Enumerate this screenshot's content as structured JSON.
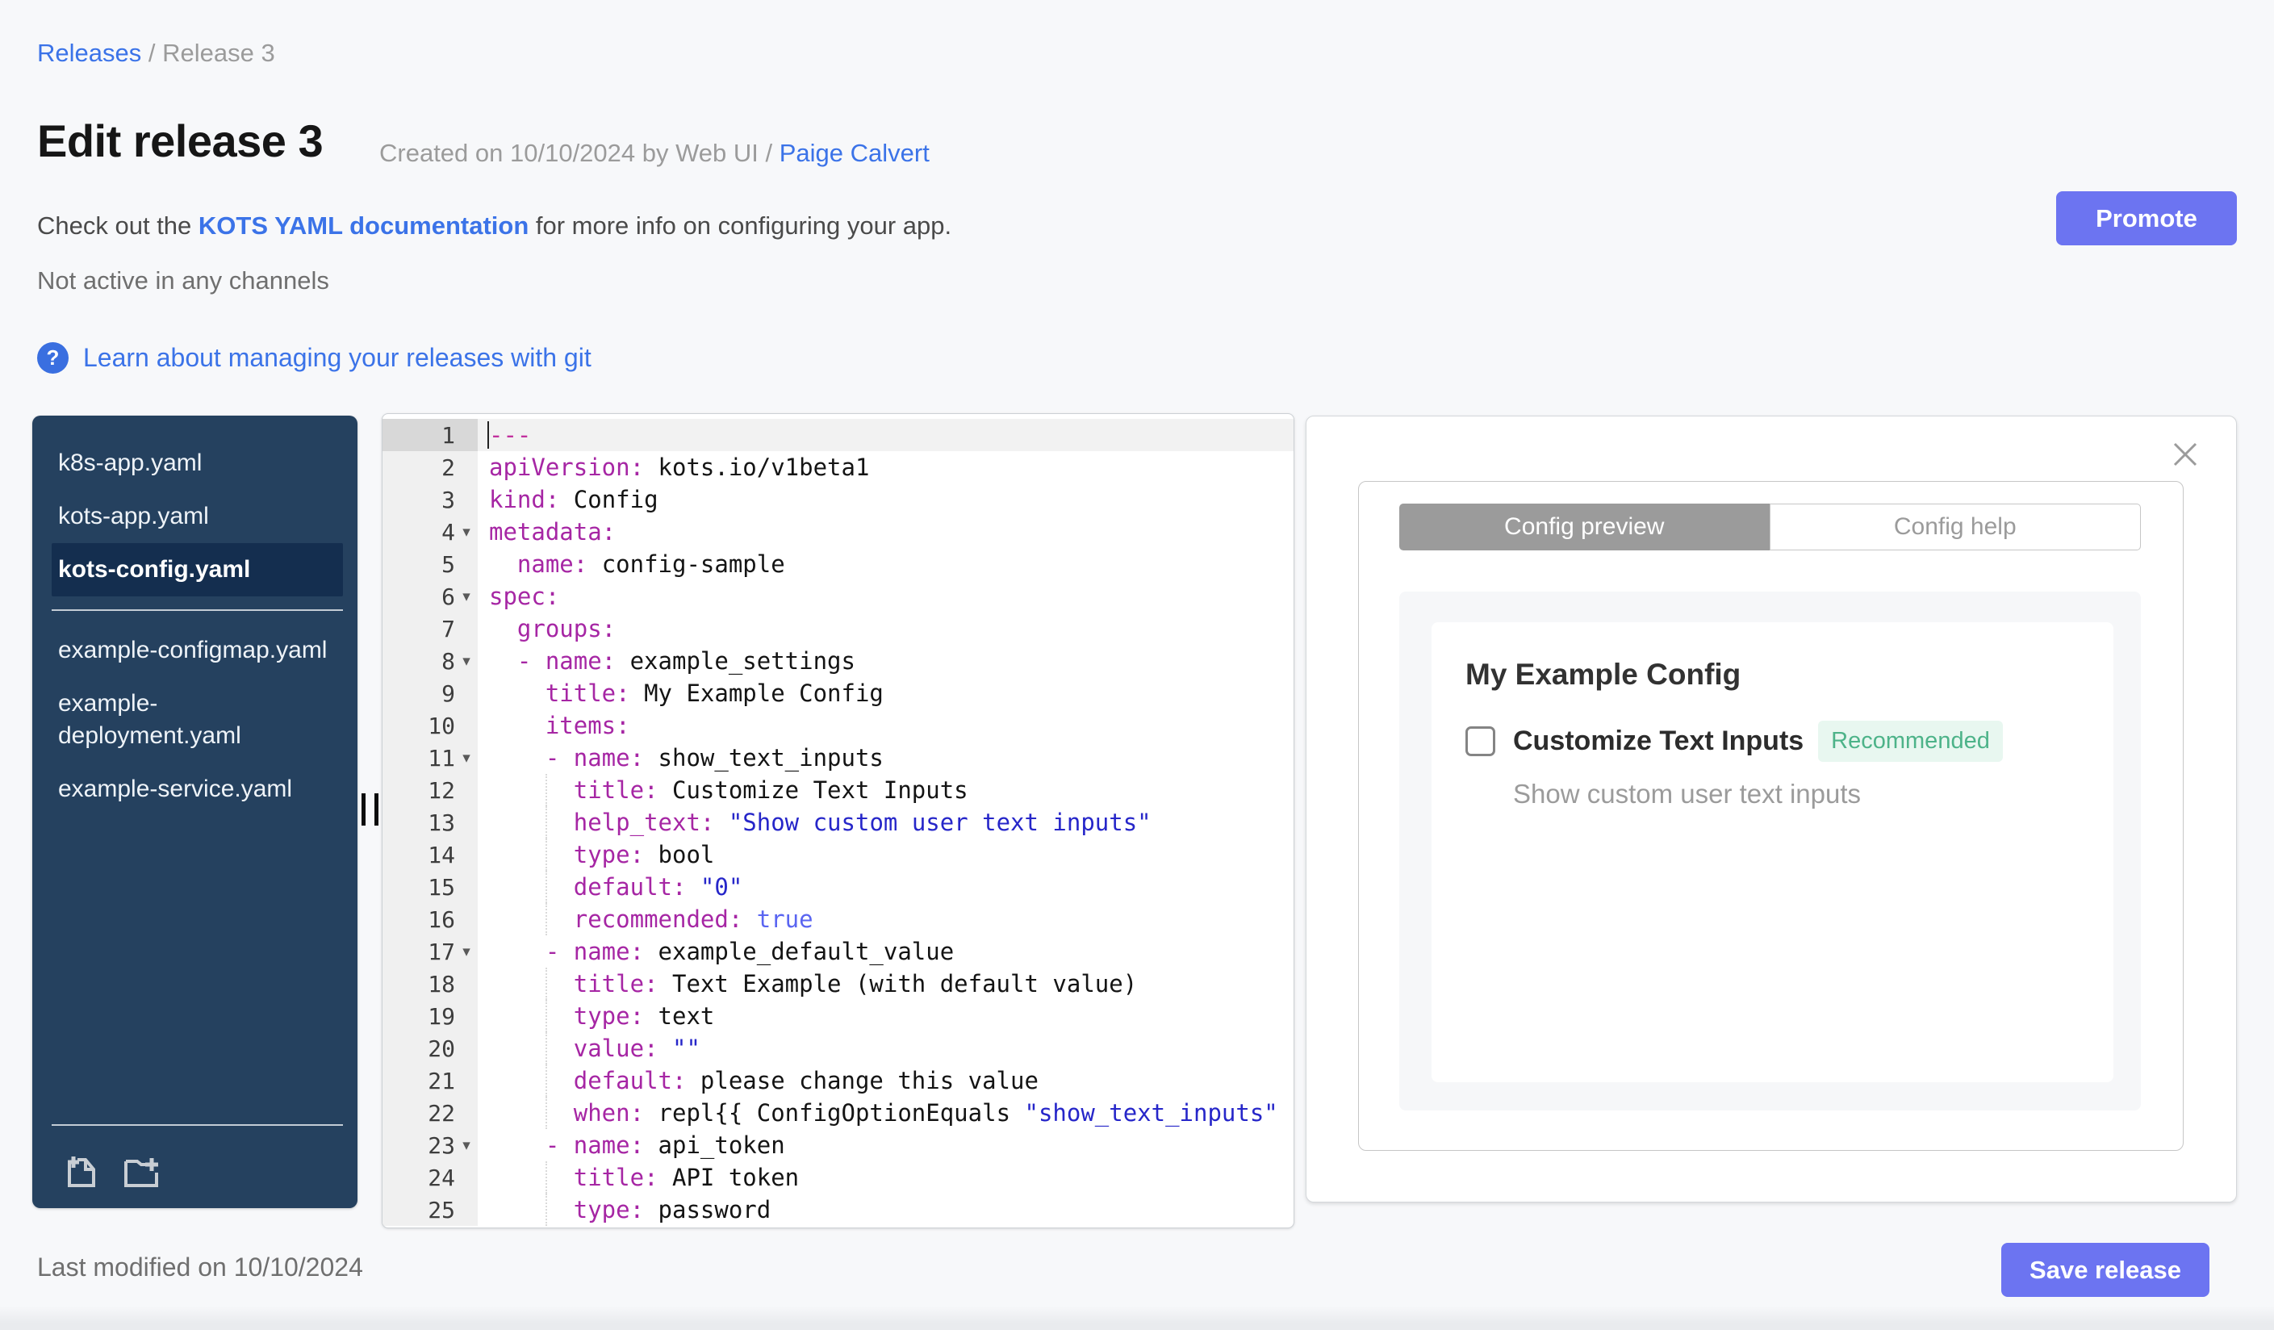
{
  "page": {
    "breadcrumb": {
      "link": "Releases",
      "separator": " / ",
      "current": "Release 3"
    },
    "title": "Edit release 3",
    "created_prefix": "Created on 10/10/2024 by Web UI / ",
    "created_author": "Paige Calvert",
    "docs_prefix": "Check out the ",
    "docs_link": "KOTS YAML documentation",
    "docs_suffix": " for more info on configuring your app.",
    "channel_status": "Not active in any channels",
    "git_help_icon": "?",
    "git_link": "Learn about managing your releases with git",
    "promote_label": "Promote",
    "last_modified": "Last modified on 10/10/2024",
    "save_label": "Save release"
  },
  "file_tree": {
    "selected": "kots-config.yaml",
    "files_top": [
      "k8s-app.yaml",
      "kots-app.yaml",
      "kots-config.yaml"
    ],
    "files_bottom": [
      "example-configmap.yaml",
      "example-deployment.yaml",
      "example-service.yaml"
    ],
    "icons": [
      "add-file-icon",
      "add-folder-icon"
    ]
  },
  "editor": {
    "lines": [
      {
        "n": 1,
        "active": true,
        "seg": [
          [
            "sep",
            "---"
          ]
        ]
      },
      {
        "n": 2,
        "seg": [
          [
            "key",
            "apiVersion:"
          ],
          [
            "plain",
            " kots.io/v1beta1"
          ]
        ]
      },
      {
        "n": 3,
        "seg": [
          [
            "key",
            "kind:"
          ],
          [
            "plain",
            " Config"
          ]
        ]
      },
      {
        "n": 4,
        "fold": true,
        "seg": [
          [
            "key",
            "metadata:"
          ]
        ]
      },
      {
        "n": 5,
        "seg": [
          [
            "plain",
            "  "
          ],
          [
            "key",
            "name:"
          ],
          [
            "plain",
            " config-sample"
          ]
        ]
      },
      {
        "n": 6,
        "fold": true,
        "seg": [
          [
            "key",
            "spec:"
          ]
        ]
      },
      {
        "n": 7,
        "seg": [
          [
            "plain",
            "  "
          ],
          [
            "key",
            "groups:"
          ]
        ]
      },
      {
        "n": 8,
        "fold": true,
        "seg": [
          [
            "plain",
            "  "
          ],
          [
            "key",
            "- name:"
          ],
          [
            "plain",
            " example_settings"
          ]
        ]
      },
      {
        "n": 9,
        "seg": [
          [
            "plain",
            "    "
          ],
          [
            "key",
            "title:"
          ],
          [
            "plain",
            " My Example Config"
          ]
        ]
      },
      {
        "n": 10,
        "seg": [
          [
            "plain",
            "    "
          ],
          [
            "key",
            "items:"
          ]
        ]
      },
      {
        "n": 11,
        "fold": true,
        "seg": [
          [
            "plain",
            "    "
          ],
          [
            "key",
            "- name:"
          ],
          [
            "plain",
            " show_text_inputs"
          ]
        ]
      },
      {
        "n": 12,
        "guide": true,
        "seg": [
          [
            "plain",
            "      "
          ],
          [
            "key",
            "title:"
          ],
          [
            "plain",
            " Customize Text Inputs"
          ]
        ]
      },
      {
        "n": 13,
        "guide": true,
        "seg": [
          [
            "plain",
            "      "
          ],
          [
            "key",
            "help_text:"
          ],
          [
            "plain",
            " "
          ],
          [
            "str",
            "\"Show custom user text inputs\""
          ]
        ]
      },
      {
        "n": 14,
        "guide": true,
        "seg": [
          [
            "plain",
            "      "
          ],
          [
            "key",
            "type:"
          ],
          [
            "plain",
            " bool"
          ]
        ]
      },
      {
        "n": 15,
        "guide": true,
        "seg": [
          [
            "plain",
            "      "
          ],
          [
            "key",
            "default:"
          ],
          [
            "plain",
            " "
          ],
          [
            "str",
            "\"0\""
          ]
        ]
      },
      {
        "n": 16,
        "guide": true,
        "seg": [
          [
            "plain",
            "      "
          ],
          [
            "key",
            "recommended:"
          ],
          [
            "plain",
            " "
          ],
          [
            "bool",
            "true"
          ]
        ]
      },
      {
        "n": 17,
        "fold": true,
        "seg": [
          [
            "plain",
            "    "
          ],
          [
            "key",
            "- name:"
          ],
          [
            "plain",
            " example_default_value"
          ]
        ]
      },
      {
        "n": 18,
        "guide": true,
        "seg": [
          [
            "plain",
            "      "
          ],
          [
            "key",
            "title:"
          ],
          [
            "plain",
            " Text Example (with default value)"
          ]
        ]
      },
      {
        "n": 19,
        "guide": true,
        "seg": [
          [
            "plain",
            "      "
          ],
          [
            "key",
            "type:"
          ],
          [
            "plain",
            " text"
          ]
        ]
      },
      {
        "n": 20,
        "guide": true,
        "seg": [
          [
            "plain",
            "      "
          ],
          [
            "key",
            "value:"
          ],
          [
            "plain",
            " "
          ],
          [
            "str",
            "\"\""
          ]
        ]
      },
      {
        "n": 21,
        "guide": true,
        "seg": [
          [
            "plain",
            "      "
          ],
          [
            "key",
            "default:"
          ],
          [
            "plain",
            " please change this value"
          ]
        ]
      },
      {
        "n": 22,
        "guide": true,
        "seg": [
          [
            "plain",
            "      "
          ],
          [
            "key",
            "when:"
          ],
          [
            "plain",
            " repl{{ ConfigOptionEquals "
          ],
          [
            "str",
            "\"show_text_inputs\""
          ]
        ]
      },
      {
        "n": 23,
        "fold": true,
        "seg": [
          [
            "plain",
            "    "
          ],
          [
            "key",
            "- name:"
          ],
          [
            "plain",
            " api_token"
          ]
        ]
      },
      {
        "n": 24,
        "guide": true,
        "seg": [
          [
            "plain",
            "      "
          ],
          [
            "key",
            "title:"
          ],
          [
            "plain",
            " API token"
          ]
        ]
      },
      {
        "n": 25,
        "guide": true,
        "seg": [
          [
            "plain",
            "      "
          ],
          [
            "key",
            "type:"
          ],
          [
            "plain",
            " password"
          ]
        ]
      }
    ]
  },
  "preview": {
    "tabs": [
      {
        "label": "Config preview",
        "active": true
      },
      {
        "label": "Config help",
        "active": false
      }
    ],
    "group_title": "My Example Config",
    "item_label": "Customize Text Inputs",
    "item_badge": "Recommended",
    "item_help": "Show custom user text inputs",
    "checkbox_checked": false
  },
  "colors": {
    "accent_button": "#6c74f1",
    "link_blue": "#3b73e8",
    "sidebar_bg": "#25415f",
    "sidebar_selected_bg": "#142e4f",
    "badge_green_text": "#4db389",
    "badge_green_bg": "#e8f7f0",
    "tab_active_bg": "#9b9b9b",
    "code_key": "#a626a4",
    "code_string": "#2626c9",
    "code_bool": "#5a65f1",
    "code_doc_separator": "#c2319e"
  }
}
